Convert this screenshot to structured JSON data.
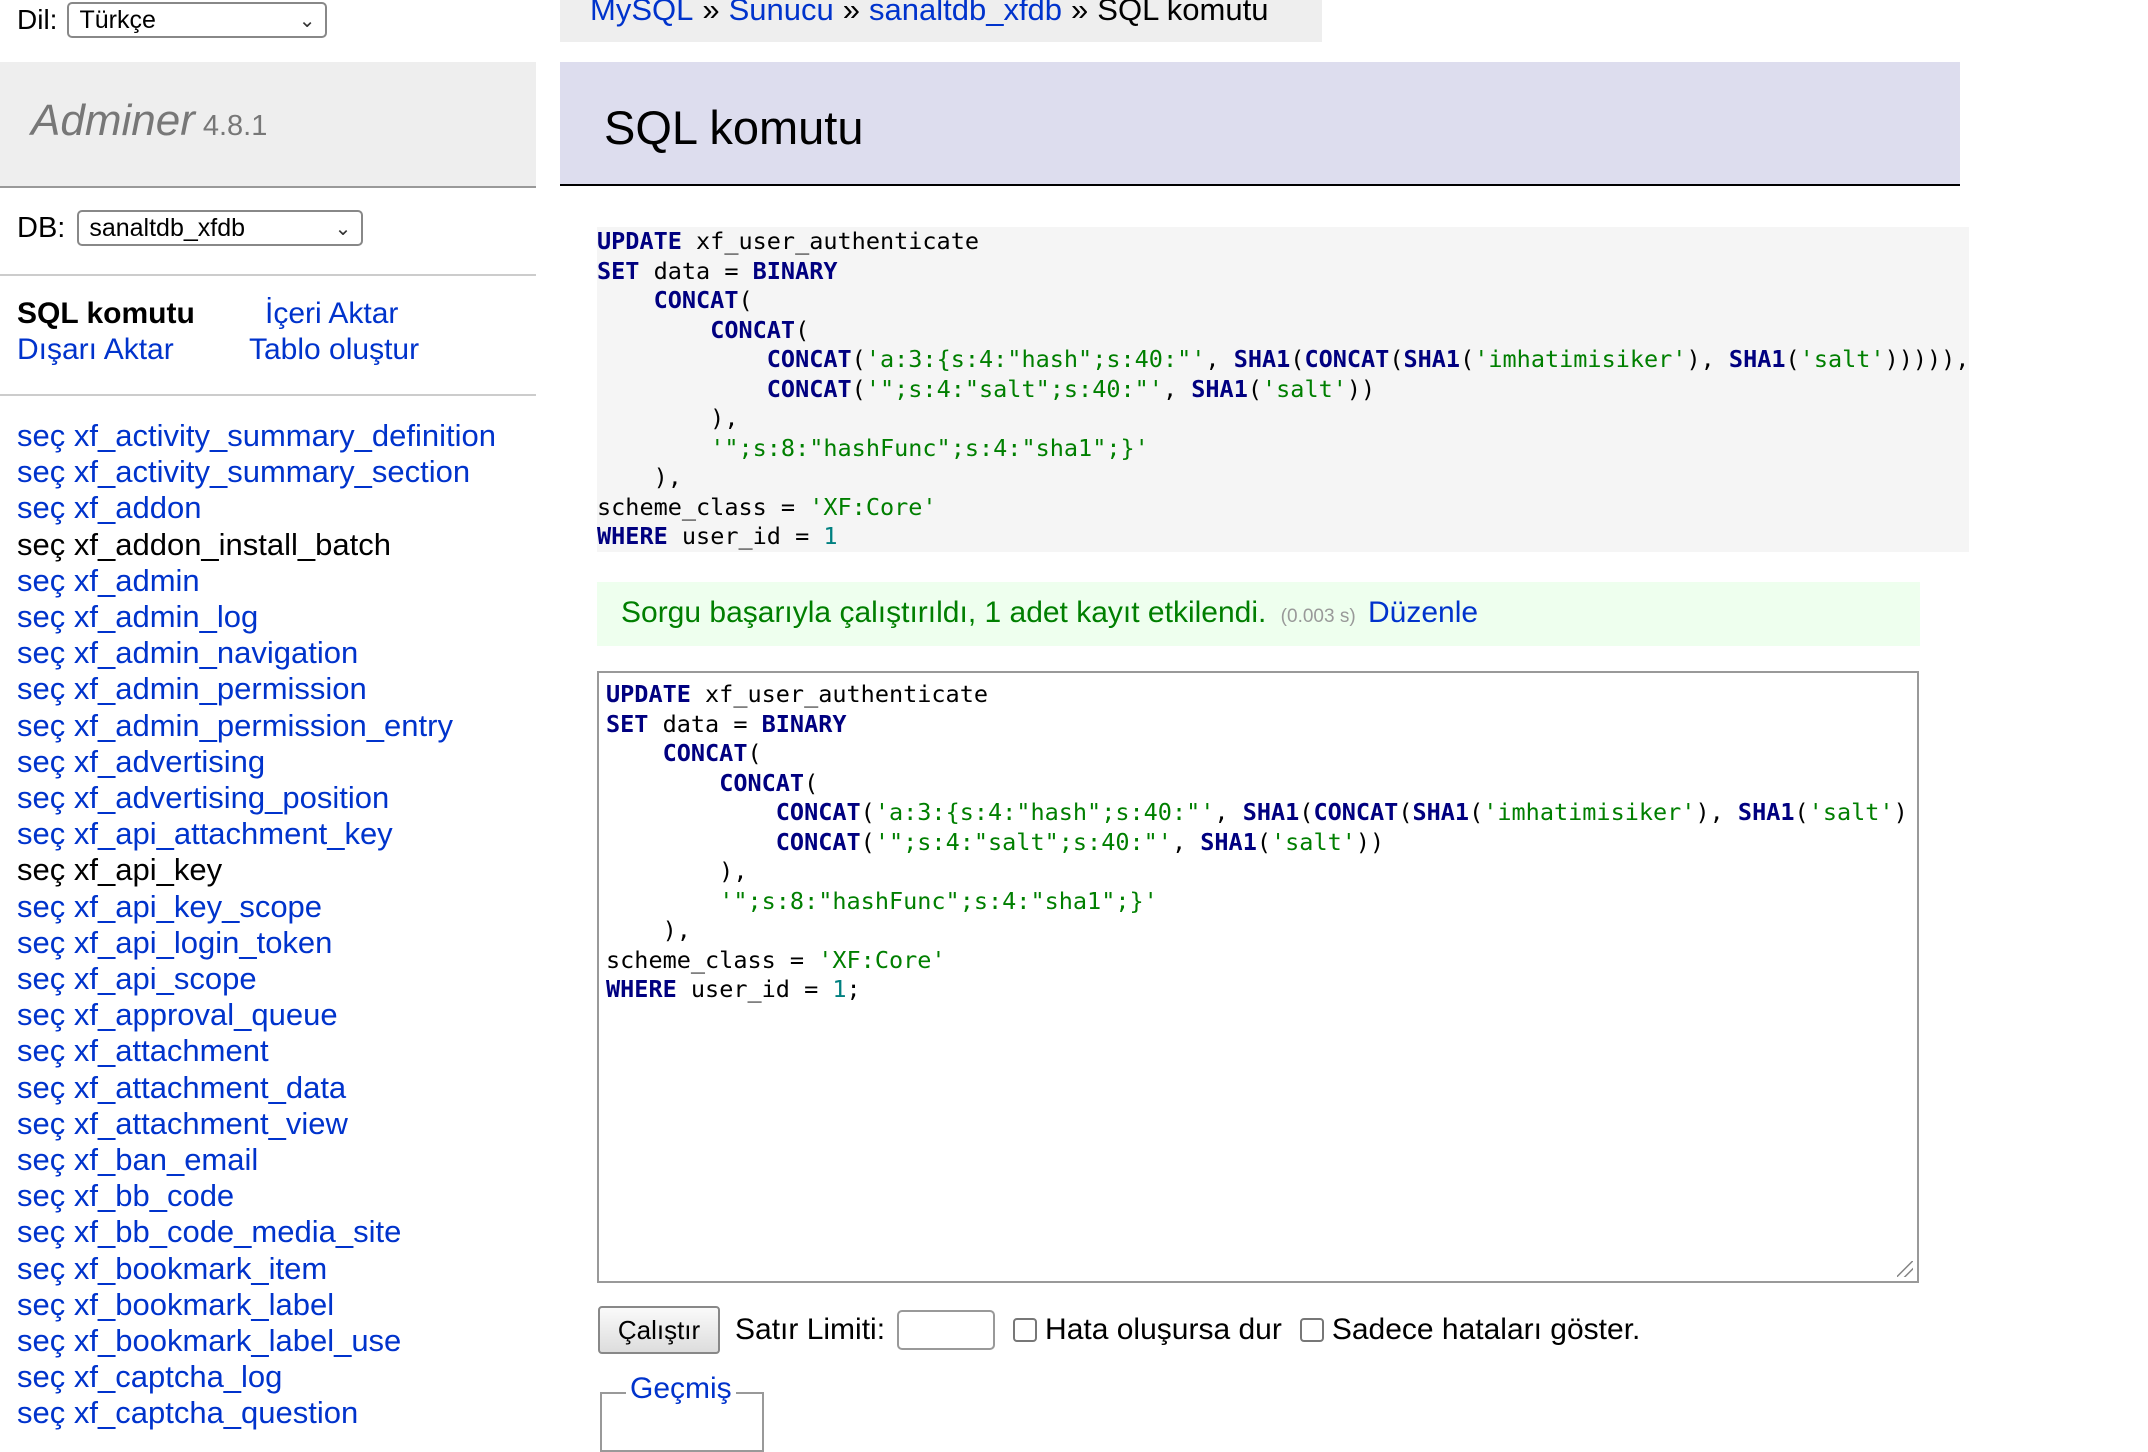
{
  "language": {
    "label": "Dil:",
    "selected": "Türkçe"
  },
  "app": {
    "name": "Adminer",
    "version": "4.8.1"
  },
  "db": {
    "label": "DB:",
    "selected": "sanaltdb_xfdb"
  },
  "menu_links": {
    "sql_command": "SQL komutu",
    "import": "İçeri Aktar",
    "export": "Dışarı Aktar",
    "create_table": "Tablo oluştur"
  },
  "tables": [
    {
      "select": "seç",
      "name": "xf_activity_summary_definition",
      "linked": true
    },
    {
      "select": "seç",
      "name": "xf_activity_summary_section",
      "linked": true
    },
    {
      "select": "seç",
      "name": "xf_addon",
      "linked": true
    },
    {
      "select": "seç",
      "name": "xf_addon_install_batch",
      "linked": false
    },
    {
      "select": "seç",
      "name": "xf_admin",
      "linked": true
    },
    {
      "select": "seç",
      "name": "xf_admin_log",
      "linked": true
    },
    {
      "select": "seç",
      "name": "xf_admin_navigation",
      "linked": true
    },
    {
      "select": "seç",
      "name": "xf_admin_permission",
      "linked": true
    },
    {
      "select": "seç",
      "name": "xf_admin_permission_entry",
      "linked": true
    },
    {
      "select": "seç",
      "name": "xf_advertising",
      "linked": true
    },
    {
      "select": "seç",
      "name": "xf_advertising_position",
      "linked": true
    },
    {
      "select": "seç",
      "name": "xf_api_attachment_key",
      "linked": true
    },
    {
      "select": "seç",
      "name": "xf_api_key",
      "linked": false
    },
    {
      "select": "seç",
      "name": "xf_api_key_scope",
      "linked": true
    },
    {
      "select": "seç",
      "name": "xf_api_login_token",
      "linked": true
    },
    {
      "select": "seç",
      "name": "xf_api_scope",
      "linked": true
    },
    {
      "select": "seç",
      "name": "xf_approval_queue",
      "linked": true
    },
    {
      "select": "seç",
      "name": "xf_attachment",
      "linked": true
    },
    {
      "select": "seç",
      "name": "xf_attachment_data",
      "linked": true
    },
    {
      "select": "seç",
      "name": "xf_attachment_view",
      "linked": true
    },
    {
      "select": "seç",
      "name": "xf_ban_email",
      "linked": true
    },
    {
      "select": "seç",
      "name": "xf_bb_code",
      "linked": true
    },
    {
      "select": "seç",
      "name": "xf_bb_code_media_site",
      "linked": true
    },
    {
      "select": "seç",
      "name": "xf_bookmark_item",
      "linked": true
    },
    {
      "select": "seç",
      "name": "xf_bookmark_label",
      "linked": true
    },
    {
      "select": "seç",
      "name": "xf_bookmark_label_use",
      "linked": true
    },
    {
      "select": "seç",
      "name": "xf_captcha_log",
      "linked": true
    },
    {
      "select": "seç",
      "name": "xf_captcha_question",
      "linked": true
    }
  ],
  "breadcrumb": {
    "mysql": "MySQL",
    "server": "Sunucu",
    "database": "sanaltdb_xfdb",
    "current": "SQL komutu",
    "separator": "»"
  },
  "page_title": "SQL komutu",
  "executed_query": [
    [
      [
        "kw",
        "UPDATE"
      ],
      [
        "t",
        " xf_user_authenticate"
      ]
    ],
    [
      [
        "kw",
        "SET"
      ],
      [
        "t",
        " data = "
      ],
      [
        "kw",
        "BINARY"
      ]
    ],
    [
      [
        "t",
        "    "
      ],
      [
        "kw",
        "CONCAT"
      ],
      [
        "t",
        "("
      ]
    ],
    [
      [
        "t",
        "        "
      ],
      [
        "kw",
        "CONCAT"
      ],
      [
        "t",
        "("
      ]
    ],
    [
      [
        "t",
        "            "
      ],
      [
        "kw",
        "CONCAT"
      ],
      [
        "t",
        "("
      ],
      [
        "str",
        "'a:3:{s:4:\"hash\";s:40:\"'"
      ],
      [
        "t",
        ", "
      ],
      [
        "kw",
        "SHA1"
      ],
      [
        "t",
        "("
      ],
      [
        "kw",
        "CONCAT"
      ],
      [
        "t",
        "("
      ],
      [
        "kw",
        "SHA1"
      ],
      [
        "t",
        "("
      ],
      [
        "str",
        "'imhatimisiker'"
      ],
      [
        "t",
        "), "
      ],
      [
        "kw",
        "SHA1"
      ],
      [
        "t",
        "("
      ],
      [
        "str",
        "'salt'"
      ],
      [
        "t",
        "))))),"
      ]
    ],
    [
      [
        "t",
        "            "
      ],
      [
        "kw",
        "CONCAT"
      ],
      [
        "t",
        "("
      ],
      [
        "str",
        "'\";s:4:\"salt\";s:40:\"'"
      ],
      [
        "t",
        ", "
      ],
      [
        "kw",
        "SHA1"
      ],
      [
        "t",
        "("
      ],
      [
        "str",
        "'salt'"
      ],
      [
        "t",
        "))"
      ]
    ],
    [
      [
        "t",
        "        ),"
      ]
    ],
    [
      [
        "t",
        "        "
      ],
      [
        "str",
        "'\";s:8:\"hashFunc\";s:4:\"sha1\";}'"
      ]
    ],
    [
      [
        "t",
        "    ),"
      ]
    ],
    [
      [
        "t",
        "scheme_class = "
      ],
      [
        "str",
        "'XF:Core'"
      ]
    ],
    [
      [
        "kw",
        "WHERE"
      ],
      [
        "t",
        " user_id = "
      ],
      [
        "num",
        "1"
      ]
    ]
  ],
  "message": {
    "text": "Sorgu başarıyla çalıştırıldı, 1 adet kayıt etkilendi.",
    "time": "(0.003 s)",
    "edit_link": "Düzenle"
  },
  "editor_query": [
    [
      [
        "kw",
        "UPDATE"
      ],
      [
        "t",
        " xf_user_authenticate"
      ]
    ],
    [
      [
        "kw",
        "SET"
      ],
      [
        "t",
        " data = "
      ],
      [
        "kw",
        "BINARY"
      ]
    ],
    [
      [
        "t",
        "    "
      ],
      [
        "kw",
        "CONCAT"
      ],
      [
        "t",
        "("
      ]
    ],
    [
      [
        "t",
        "        "
      ],
      [
        "kw",
        "CONCAT"
      ],
      [
        "t",
        "("
      ]
    ],
    [
      [
        "t",
        "            "
      ],
      [
        "kw",
        "CONCAT"
      ],
      [
        "t",
        "("
      ],
      [
        "str",
        "'a:3:{s:4:\"hash\";s:40:\"'"
      ],
      [
        "t",
        ", "
      ],
      [
        "kw",
        "SHA1"
      ],
      [
        "t",
        "("
      ],
      [
        "kw",
        "CONCAT"
      ],
      [
        "t",
        "("
      ],
      [
        "kw",
        "SHA1"
      ],
      [
        "t",
        "("
      ],
      [
        "str",
        "'imhatimisiker'"
      ],
      [
        "t",
        "), "
      ],
      [
        "kw",
        "SHA1"
      ],
      [
        "t",
        "("
      ],
      [
        "str",
        "'salt'"
      ],
      [
        "t",
        ")"
      ]
    ],
    [
      [
        "t",
        "            "
      ],
      [
        "kw",
        "CONCAT"
      ],
      [
        "t",
        "("
      ],
      [
        "str",
        "'\";s:4:\"salt\";s:40:\"'"
      ],
      [
        "t",
        ", "
      ],
      [
        "kw",
        "SHA1"
      ],
      [
        "t",
        "("
      ],
      [
        "str",
        "'salt'"
      ],
      [
        "t",
        "))"
      ]
    ],
    [
      [
        "t",
        "        ),"
      ]
    ],
    [
      [
        "t",
        "        "
      ],
      [
        "str",
        "'\";s:8:\"hashFunc\";s:4:\"sha1\";}'"
      ]
    ],
    [
      [
        "t",
        "    ),"
      ]
    ],
    [
      [
        "t",
        "scheme_class = "
      ],
      [
        "str",
        "'XF:Core'"
      ]
    ],
    [
      [
        "kw",
        "WHERE"
      ],
      [
        "t",
        " user_id = "
      ],
      [
        "num",
        "1"
      ],
      [
        "t",
        ";"
      ]
    ]
  ],
  "form": {
    "run_button": "Çalıştır",
    "limit_label": "Satır Limiti:",
    "limit_value": "",
    "stop_on_error_label": "Hata oluşursa dur",
    "only_errors_label": "Sadece hataları göster.",
    "stop_on_error_checked": false,
    "only_errors_checked": false
  },
  "history": {
    "legend": "Geçmiş"
  },
  "icons": {
    "select_chevron": "chevron-down-icon",
    "resize_grip": "resize-grip-icon"
  }
}
